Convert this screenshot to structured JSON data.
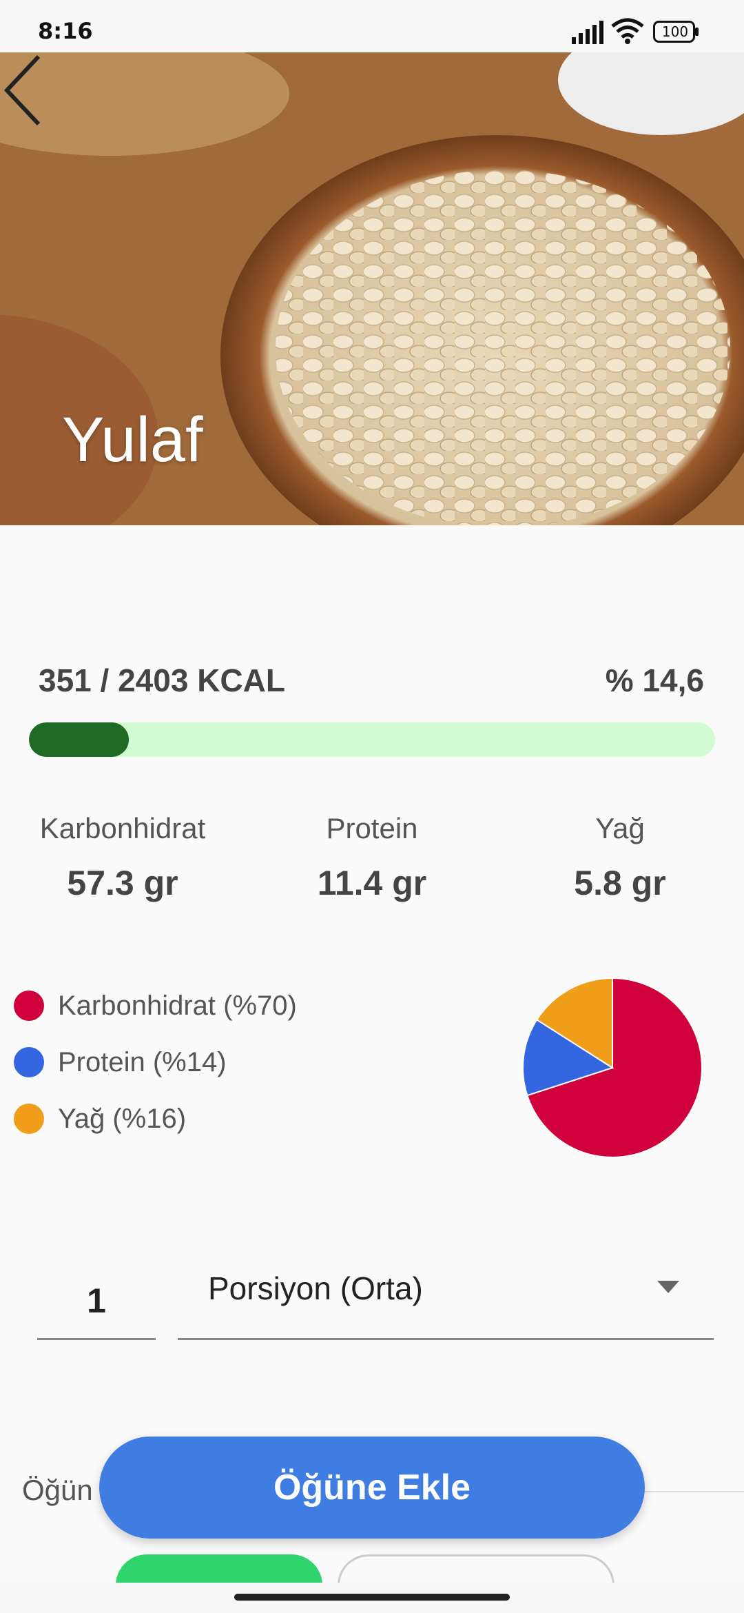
{
  "status_bar": {
    "time": "8:16",
    "battery": "100",
    "icons": [
      "signal-icon",
      "wifi-icon",
      "battery-icon"
    ]
  },
  "header": {
    "title": "Yulaf",
    "back_icon": "chevron-left-icon"
  },
  "calories": {
    "text": "351 / 2403 KCAL",
    "percent_text": "% 14,6",
    "progress_fraction": 0.146
  },
  "macros": [
    {
      "label": "Karbonhidrat",
      "value": "57.3 gr"
    },
    {
      "label": "Protein",
      "value": "11.4 gr"
    },
    {
      "label": "Yağ",
      "value": "5.8 gr"
    }
  ],
  "chart_data": {
    "type": "pie",
    "categories": [
      "Karbonhidrat (%70)",
      "Protein (%14)",
      "Yağ (%16)"
    ],
    "values": [
      70,
      14,
      16
    ],
    "colors": [
      "#d0003b",
      "#3366e0",
      "#f09e1a"
    ],
    "legend": "left"
  },
  "portion": {
    "quantity": "1",
    "unit": "Porsiyon (Orta)",
    "dropdown_icon": "triangle-down-icon"
  },
  "meal": {
    "label": "Öğün"
  },
  "actions": {
    "add_button": "Öğüne Ekle"
  }
}
